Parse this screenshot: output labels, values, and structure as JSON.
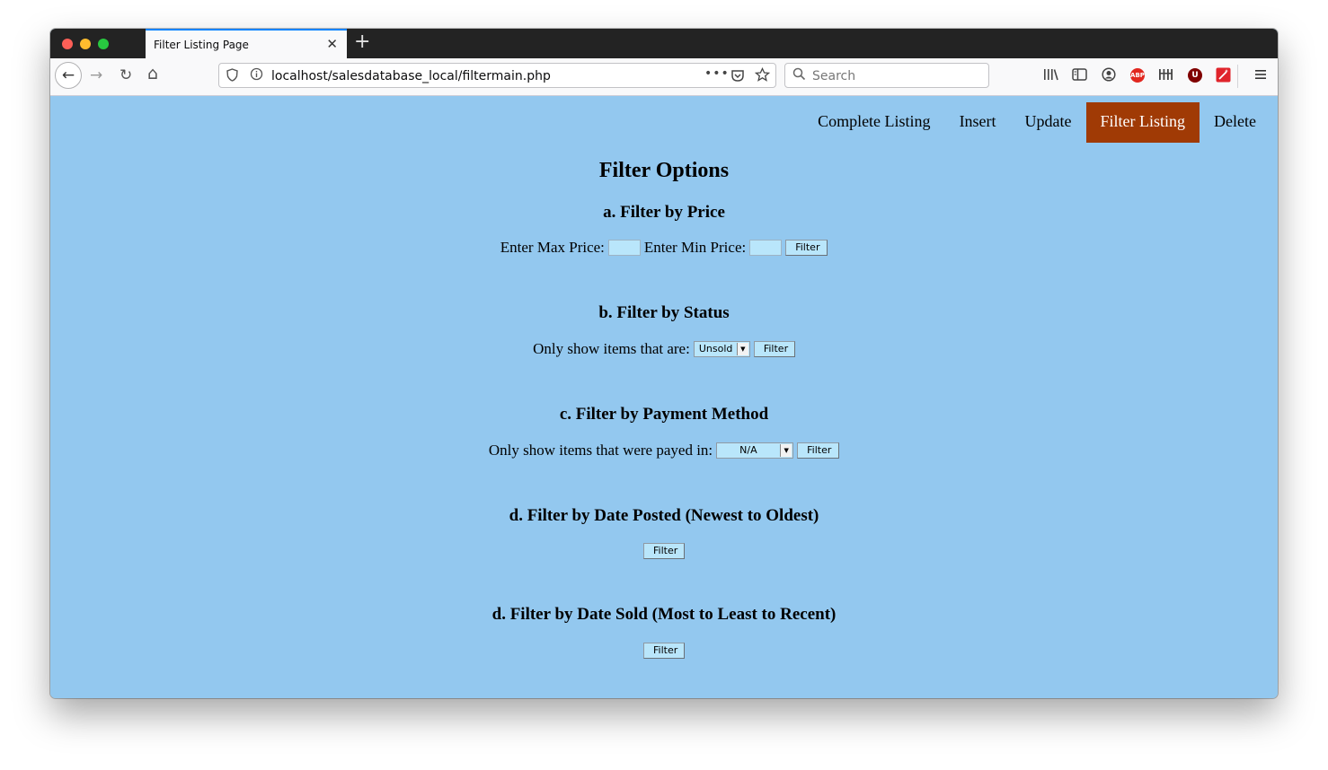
{
  "browser": {
    "tab_title": "Filter Listing Page",
    "tab_close": "✕",
    "new_tab": "+",
    "back": "←",
    "forward": "→",
    "reload": "↻",
    "home": "⌂",
    "url": "localhost/salesdatabase_local/filtermain.php",
    "url_more": "•••",
    "search_placeholder": "Search",
    "extensions": {
      "abp": "ABP",
      "ublock": "U"
    }
  },
  "nav": {
    "items": [
      "Complete Listing",
      "Insert",
      "Update",
      "Filter Listing",
      "Delete"
    ],
    "active": "Filter Listing"
  },
  "page": {
    "title": "Filter Options",
    "price": {
      "heading": "a. Filter by Price",
      "max_label": "Enter Max Price:",
      "max_value": "",
      "min_label": "Enter Min Price:",
      "min_value": "",
      "button": "Filter"
    },
    "status": {
      "heading": "b. Filter by Status",
      "label": "Only show items that are:",
      "selected": "Unsold",
      "button": "Filter"
    },
    "payment": {
      "heading": "c. Filter by Payment Method",
      "label": "Only show items that were payed in:",
      "selected": "N/A",
      "button": "Filter"
    },
    "date_posted": {
      "heading": "d. Filter by Date Posted (Newest to Oldest)",
      "button": "Filter"
    },
    "date_sold": {
      "heading": "d. Filter by Date Sold (Most to Least to Recent)",
      "button": "Filter"
    }
  },
  "colors": {
    "page_bg": "#93c8ef",
    "nav_active": "#a03a05",
    "input_bg": "#b9e6fb"
  }
}
